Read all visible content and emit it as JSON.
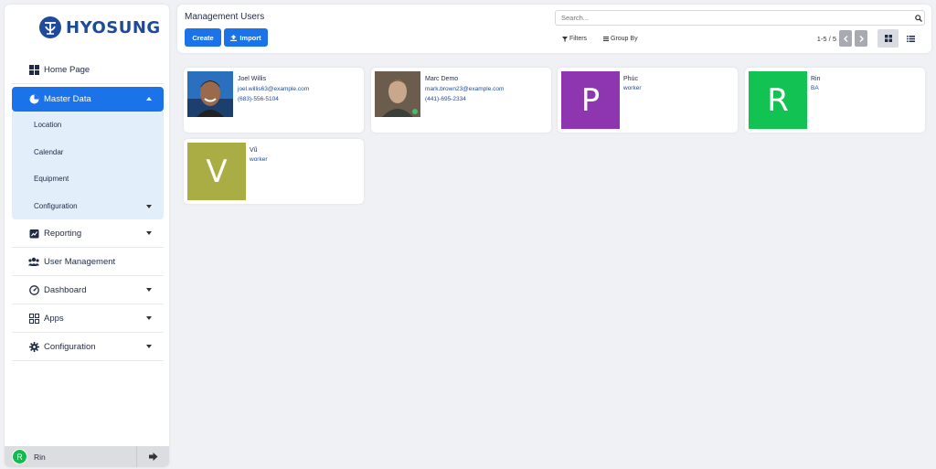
{
  "brand": {
    "name": "HYOSUNG"
  },
  "nav": {
    "home": "Home Page",
    "master_data": "Master Data",
    "master_sub": [
      "Location",
      "Calendar",
      "Equipment",
      "Configuration"
    ],
    "reporting": "Reporting",
    "user_management": "User Management",
    "dashboard": "Dashboard",
    "apps": "Apps",
    "configuration": "Configuration"
  },
  "user": {
    "initial": "R",
    "name": "Rin"
  },
  "control": {
    "title": "Management Users",
    "create": "Create",
    "import": "Import",
    "search_placeholder": "Search...",
    "filters": "Filters",
    "group_by": "Group By",
    "pager": "1-5 / 5"
  },
  "cards": [
    {
      "name": "Joel Willis",
      "line2": "joel.willis63@example.com",
      "line3": "(683)-556-5104"
    },
    {
      "name": "Marc Demo",
      "line2": "mark.brown23@example.com",
      "line3": "(441)-695-2334"
    },
    {
      "name": "Phúc",
      "line2": "worker",
      "initial": "P",
      "color": "#8e36b0"
    },
    {
      "name": "Rin",
      "line2": "BA",
      "initial": "R",
      "color": "#12c253"
    },
    {
      "name": "Vũ",
      "line2": "worker",
      "initial": "V",
      "color": "#aaad44"
    }
  ],
  "colors": {
    "primary": "#1a73e8",
    "submenu_bg": "#e3eefb"
  }
}
